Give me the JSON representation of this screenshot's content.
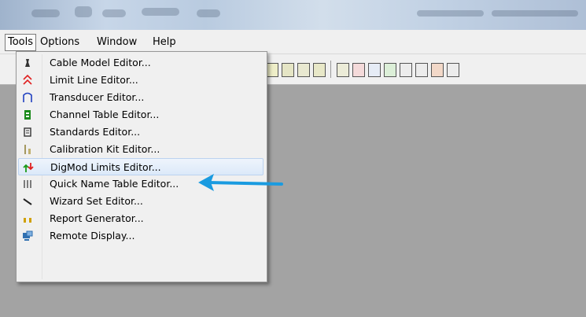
{
  "menubar": {
    "items": [
      {
        "label": "Tools"
      },
      {
        "label": "Options"
      },
      {
        "label": "Window"
      },
      {
        "label": "Help"
      }
    ]
  },
  "tools_menu": {
    "items": [
      {
        "label": "Cable Model Editor...",
        "icon": "cable-icon",
        "color": "#333333"
      },
      {
        "label": "Limit Line Editor...",
        "icon": "limit-line-icon",
        "color": "#e02020"
      },
      {
        "label": "Transducer Editor...",
        "icon": "transducer-icon",
        "color": "#2040c0"
      },
      {
        "label": "Channel Table Editor...",
        "icon": "channel-table-icon",
        "color": "#1a8a1a"
      },
      {
        "label": "Standards Editor...",
        "icon": "standards-icon",
        "color": "#333333"
      },
      {
        "label": "Calibration Kit Editor...",
        "icon": "calibration-kit-icon",
        "color": "#8a7a30"
      },
      {
        "label": "DigMod Limits Editor...",
        "icon": "digmod-limits-icon",
        "color": "#1a9a1a"
      },
      {
        "label": "Quick Name Table Editor...",
        "icon": "quick-name-table-icon",
        "color": "#555555"
      },
      {
        "label": "Wizard Set Editor...",
        "icon": "wizard-wand-icon",
        "color": "#222222"
      },
      {
        "label": "Report Generator...",
        "icon": "report-generator-icon",
        "color": "#d0a000"
      },
      {
        "label": "Remote Display...",
        "icon": "remote-display-icon",
        "color": "#3070b0"
      }
    ],
    "highlighted_index": 6
  },
  "annotation": {
    "arrow_color": "#1a9be0"
  }
}
